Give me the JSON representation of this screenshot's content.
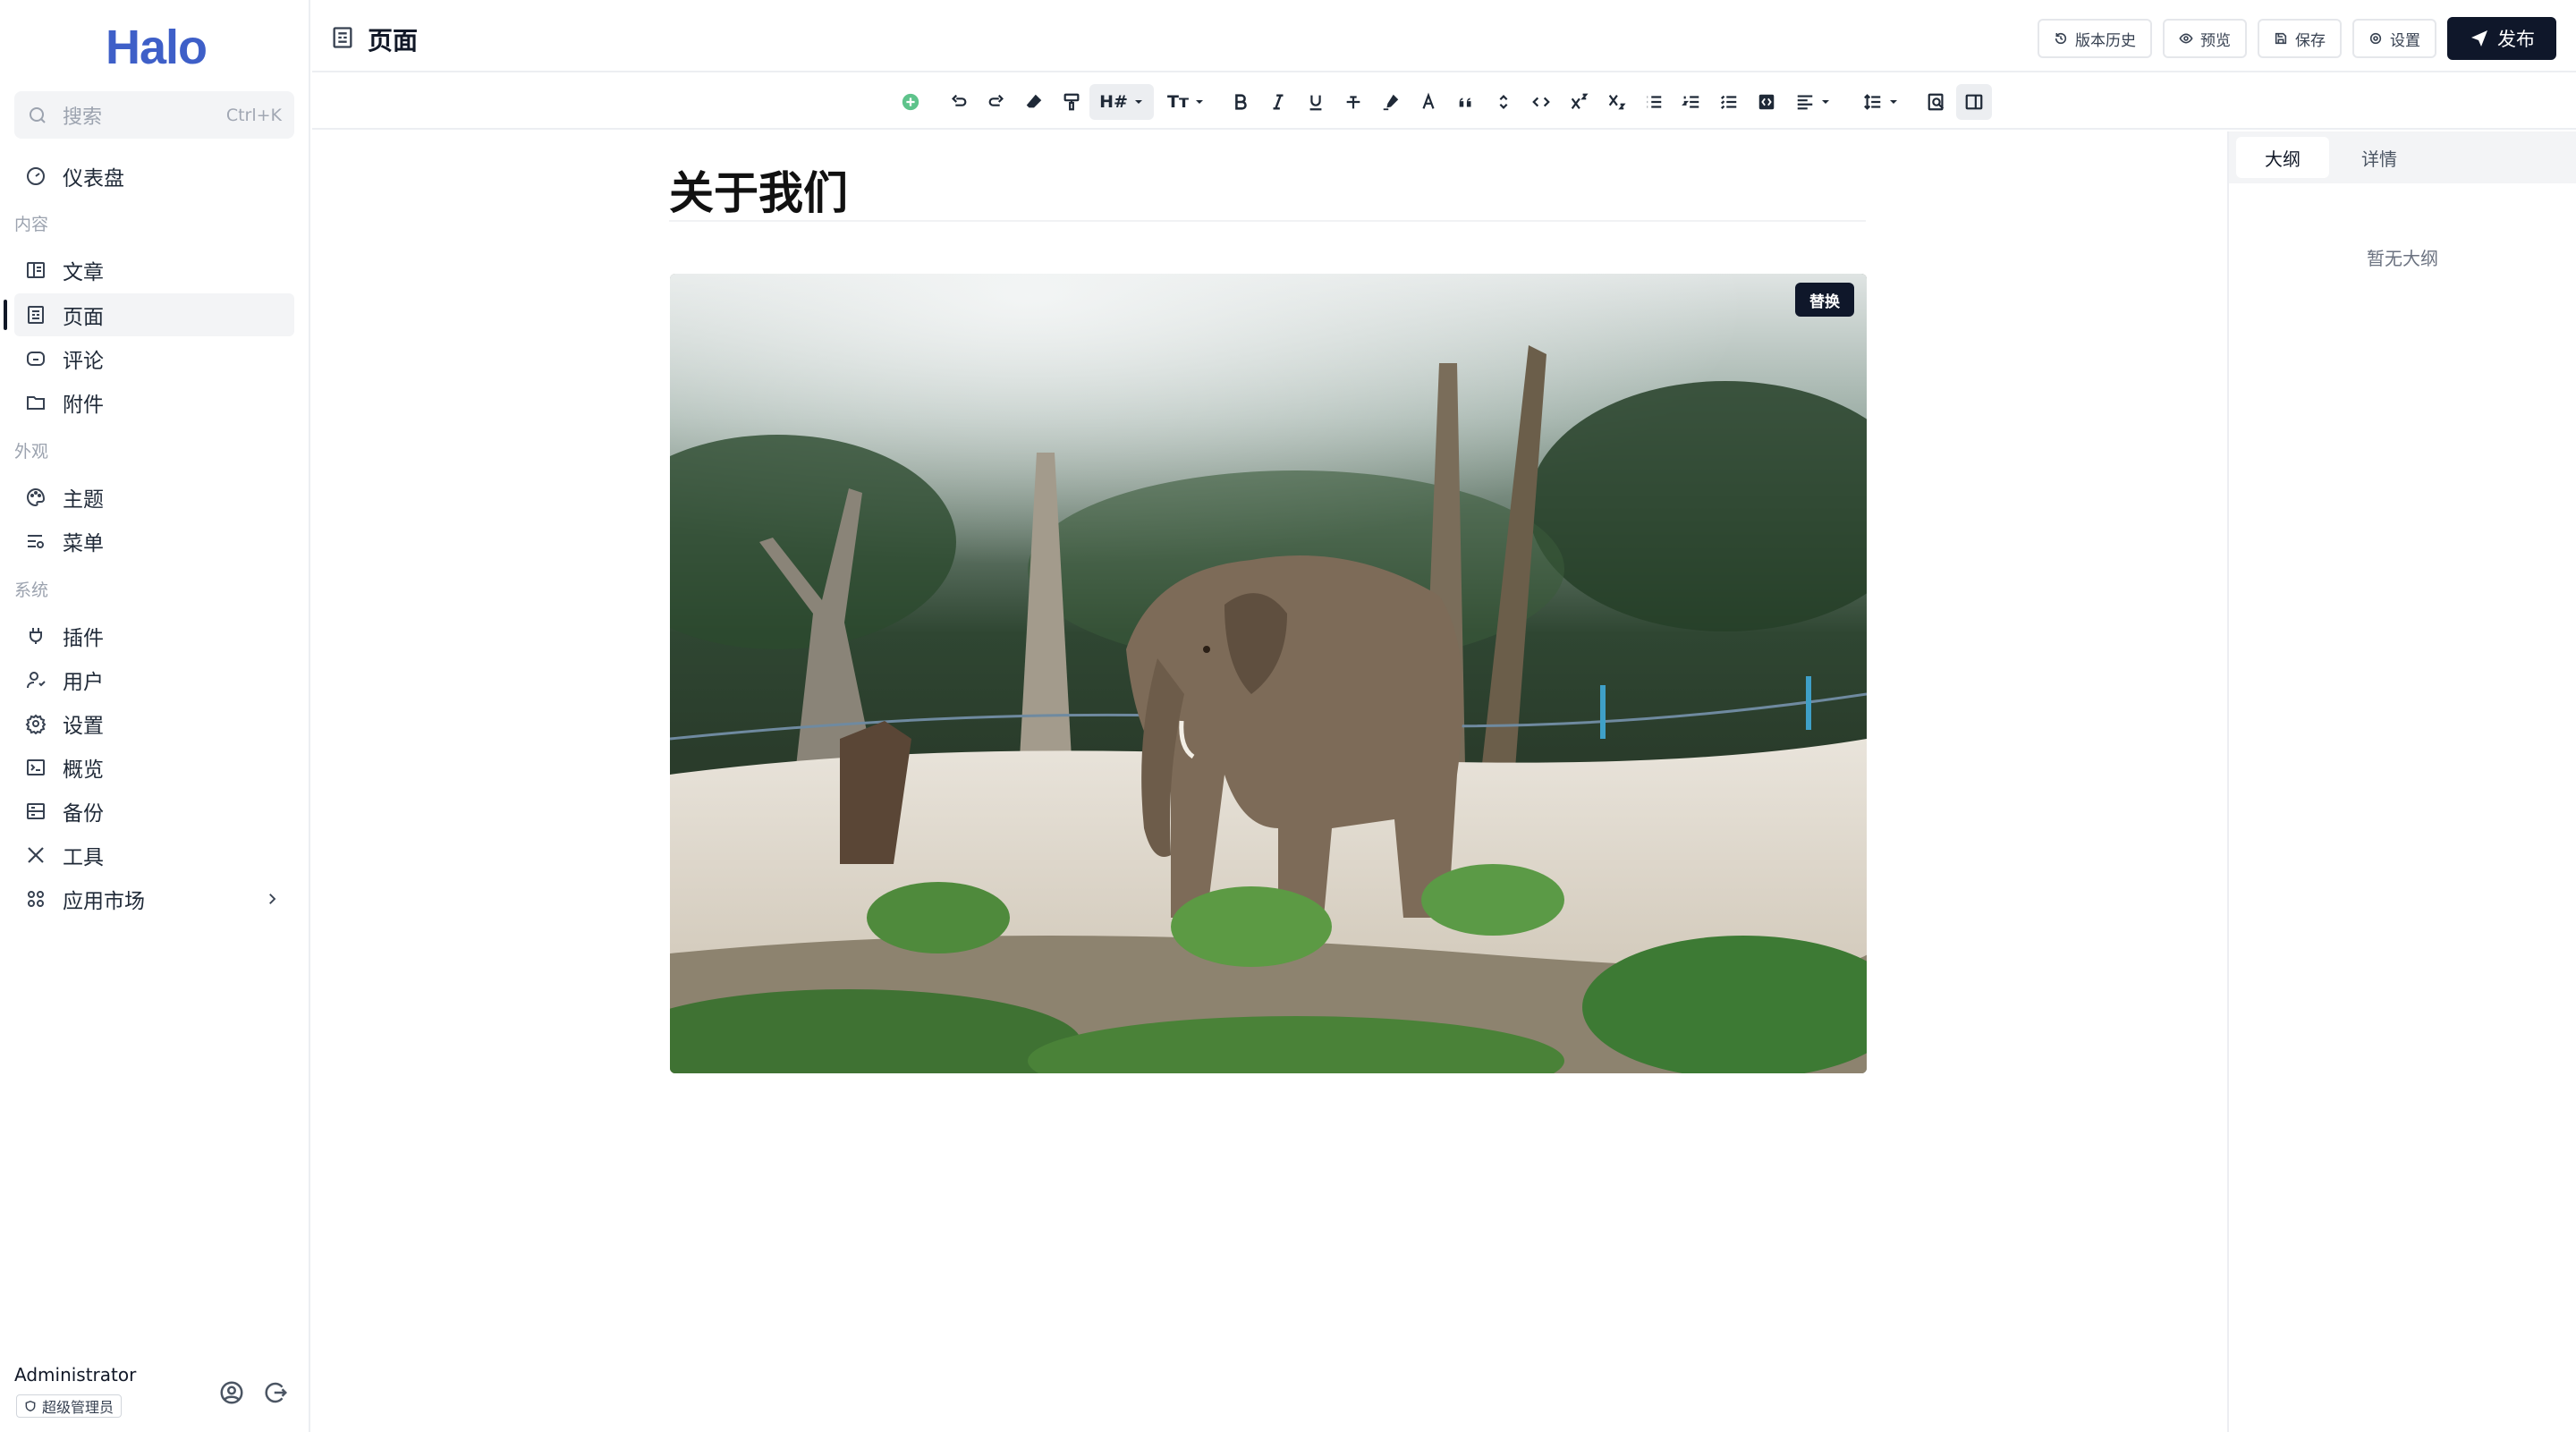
{
  "app": {
    "logo": "Halo"
  },
  "search": {
    "placeholder": "搜索",
    "shortcut": "Ctrl+K"
  },
  "sidebar": {
    "dashboard": "仪表盘",
    "groups": {
      "content": "内容",
      "appearance": "外观",
      "system": "系统"
    },
    "items": {
      "posts": "文章",
      "pages": "页面",
      "comments": "评论",
      "attachments": "附件",
      "themes": "主题",
      "menus": "菜单",
      "plugins": "插件",
      "users": "用户",
      "settings": "设置",
      "overview": "概览",
      "backup": "备份",
      "tools": "工具",
      "marketplace": "应用市场"
    },
    "active": "pages"
  },
  "user": {
    "name": "Administrator",
    "role": "超级管理员"
  },
  "header": {
    "title": "页面",
    "buttons": {
      "history": "版本历史",
      "preview": "预览",
      "save": "保存",
      "settings": "设置",
      "publish": "发布"
    }
  },
  "toolbar": {
    "heading_label": "H#",
    "font_size_label": "Tт"
  },
  "editor": {
    "doc_title": "关于我们",
    "image_replace": "替换"
  },
  "right_panel": {
    "tabs": [
      "大纲",
      "详情"
    ],
    "active_tab": "大纲",
    "empty_text": "暂无大纲"
  },
  "colors": {
    "brand": "#3e5fc8",
    "primary_button": "#0f172a",
    "add_block": "#5ec38b"
  }
}
